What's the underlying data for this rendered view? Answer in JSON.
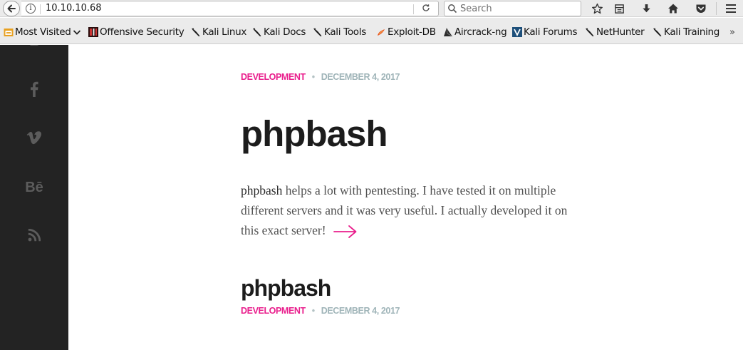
{
  "browser": {
    "url": "10.10.10.68",
    "search_placeholder": "Search",
    "bookmarks_overflow": "»",
    "bookmarks": [
      {
        "label": "Most Visited",
        "icon": "folder-icon",
        "dropdown": true
      },
      {
        "label": "Offensive Security",
        "icon": "offsec-icon"
      },
      {
        "label": "Kali Linux",
        "icon": "kali-dragon-icon"
      },
      {
        "label": "Kali Docs",
        "icon": "kali-dragon-icon"
      },
      {
        "label": "Kali Tools",
        "icon": "kali-dragon-icon"
      },
      {
        "label": "Exploit-DB",
        "icon": "exploitdb-icon"
      },
      {
        "label": "Aircrack-ng",
        "icon": "aircrack-icon"
      },
      {
        "label": "Kali Forums",
        "icon": "kali-forums-icon"
      },
      {
        "label": "NetHunter",
        "icon": "kali-dragon-icon"
      },
      {
        "label": "Kali Training",
        "icon": "kali-dragon-icon"
      }
    ]
  },
  "sidebar": {
    "social": [
      {
        "name": "facebook",
        "glyph": "f"
      },
      {
        "name": "vimeo",
        "glyph": "v"
      },
      {
        "name": "behance",
        "glyph": "Bē"
      },
      {
        "name": "rss",
        "glyph": "rss"
      }
    ]
  },
  "posts": [
    {
      "category": "DEVELOPMENT",
      "separator": "•",
      "date": "DECEMBER 4, 2017",
      "title": "phpbash",
      "excerpt_strong": "phpbash",
      "excerpt_rest": " helps a lot with pentesting. I have tested it on multiple different servers and it was very useful. I actually developed it on this exact server!"
    },
    {
      "category": "DEVELOPMENT",
      "separator": "•",
      "date": "DECEMBER 4, 2017",
      "title": "phpbash"
    }
  ],
  "colors": {
    "accent": "#e91e8c",
    "date": "#9fb4b8",
    "sidebar_bg": "#232323",
    "heading": "#1c1c1c"
  }
}
